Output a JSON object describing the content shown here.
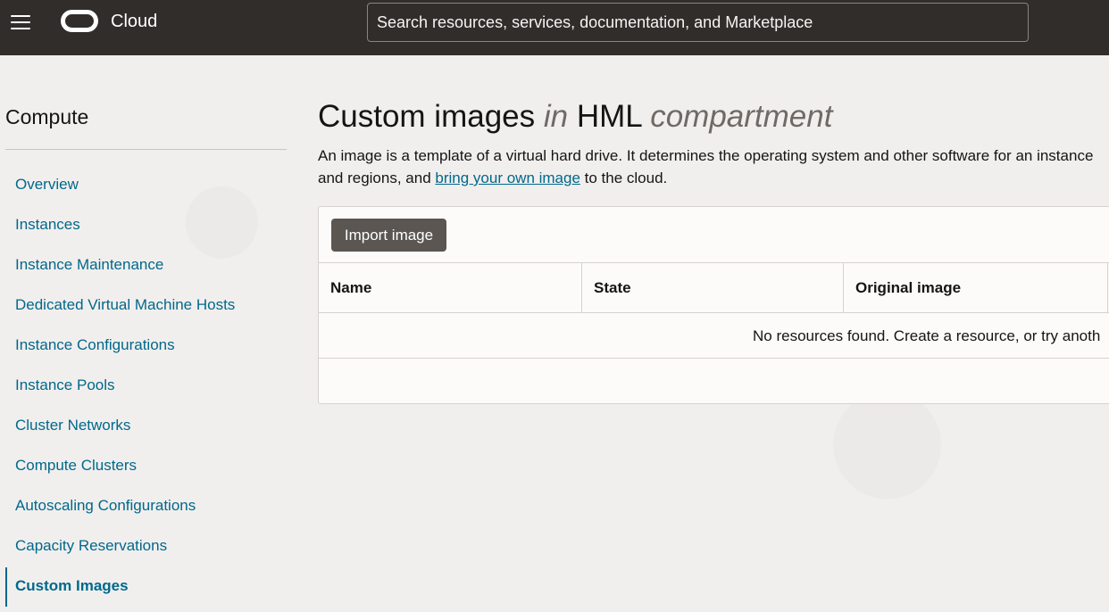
{
  "header": {
    "brand": "Cloud",
    "search_placeholder": "Search resources, services, documentation, and Marketplace"
  },
  "sidebar": {
    "title": "Compute",
    "items": [
      {
        "label": "Overview"
      },
      {
        "label": "Instances"
      },
      {
        "label": "Instance Maintenance"
      },
      {
        "label": "Dedicated Virtual Machine Hosts"
      },
      {
        "label": "Instance Configurations"
      },
      {
        "label": "Instance Pools"
      },
      {
        "label": "Cluster Networks"
      },
      {
        "label": "Compute Clusters"
      },
      {
        "label": "Autoscaling Configurations"
      },
      {
        "label": "Capacity Reservations"
      },
      {
        "label": "Custom Images",
        "active": true
      }
    ]
  },
  "main": {
    "title_part1": "Custom images",
    "title_in": "in",
    "title_compartment": "HML",
    "title_suffix": "compartment",
    "description_before": "An image is a template of a virtual hard drive. It determines the operating system and other software for an instance",
    "description_line2_before": "and regions, and ",
    "description_link": "bring your own image",
    "description_after": " to the cloud.",
    "import_button": "Import image",
    "table": {
      "columns": [
        "Name",
        "State",
        "Original image"
      ],
      "empty_message": "No resources found. Create a resource, or try anoth"
    }
  },
  "colors": {
    "topbar": "#312d2a",
    "link": "#00688c",
    "button": "#5b5652"
  }
}
